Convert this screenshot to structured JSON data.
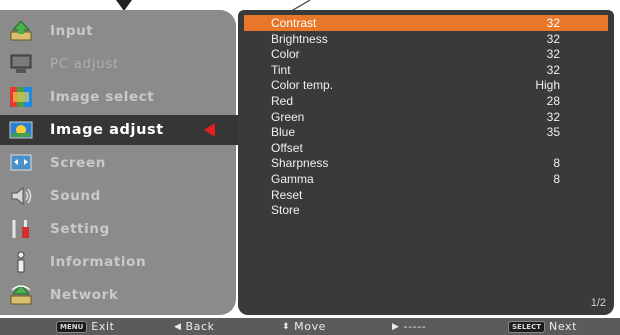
{
  "menu": {
    "items": [
      {
        "label": "Input",
        "icon": "input-icon",
        "state": "normal"
      },
      {
        "label": "PC adjust",
        "icon": "pc-adjust-icon",
        "state": "dim"
      },
      {
        "label": "Image select",
        "icon": "image-select-icon",
        "state": "normal"
      },
      {
        "label": "Image adjust",
        "icon": "image-adjust-icon",
        "state": "selected"
      },
      {
        "label": "Screen",
        "icon": "screen-icon",
        "state": "normal"
      },
      {
        "label": "Sound",
        "icon": "sound-icon",
        "state": "normal"
      },
      {
        "label": "Setting",
        "icon": "setting-icon",
        "state": "normal"
      },
      {
        "label": "Information",
        "icon": "information-icon",
        "state": "normal"
      },
      {
        "label": "Network",
        "icon": "network-icon",
        "state": "normal"
      }
    ]
  },
  "settings": {
    "rows": [
      {
        "name": "Contrast",
        "value": "32"
      },
      {
        "name": "Brightness",
        "value": "32"
      },
      {
        "name": "Color",
        "value": "32"
      },
      {
        "name": "Tint",
        "value": "32"
      },
      {
        "name": "Color temp.",
        "value": "High"
      },
      {
        "name": "Red",
        "value": "28"
      },
      {
        "name": "Green",
        "value": "32"
      },
      {
        "name": "Blue",
        "value": "35"
      },
      {
        "name": "Offset",
        "value": ""
      },
      {
        "name": "Sharpness",
        "value": "8"
      },
      {
        "name": "Gamma",
        "value": "8"
      },
      {
        "name": "Reset",
        "value": ""
      },
      {
        "name": "Store",
        "value": ""
      }
    ],
    "selected_index": 0,
    "page": "1/2"
  },
  "footer": {
    "exit_key": "MENU",
    "exit_label": "Exit",
    "back_glyph": "◀",
    "back_label": "Back",
    "move_glyph": "⬍",
    "move_label": "Move",
    "forward_glyph": "▶",
    "forward_label": "-----",
    "next_key": "SELECT",
    "next_label": "Next"
  },
  "colors": {
    "menu_bg": "#8b8b8b",
    "menu_selected_bg": "#363636",
    "selection_arrow": "#e02020",
    "settings_bg": "#3a3a3a",
    "row_highlight": "#e8772a",
    "footer_bg": "#5b5b5b"
  }
}
